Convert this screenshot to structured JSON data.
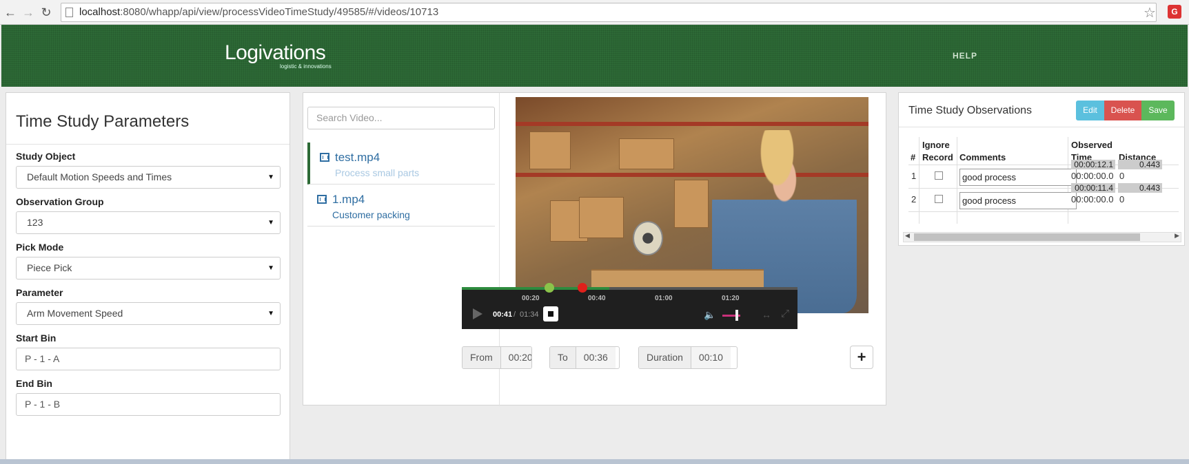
{
  "browser": {
    "url_host": "localhost",
    "url_rest": ":8080/whapp/api/view/processVideoTimeStudy/49585/#/videos/10713"
  },
  "header": {
    "logo": "Logivations",
    "logo_sub": "logistic & innovations",
    "help": "HELP",
    "color": "#2d6a36"
  },
  "params": {
    "title": "Time Study Parameters",
    "study_object": {
      "label": "Study Object",
      "value": "Default Motion Speeds and Times"
    },
    "observation_group": {
      "label": "Observation Group",
      "value": "123"
    },
    "pick_mode": {
      "label": "Pick Mode",
      "value": "Piece Pick"
    },
    "parameter": {
      "label": "Parameter",
      "value": "Arm Movement Speed"
    },
    "start_bin": {
      "label": "Start Bin",
      "value": "P - 1 - A"
    },
    "end_bin": {
      "label": "End Bin",
      "value": "P - 1 - B"
    }
  },
  "videos": {
    "search_placeholder": "Search Video...",
    "items": [
      {
        "name": "test.mp4",
        "desc": "Process small parts",
        "active": true
      },
      {
        "name": "1.mp4",
        "desc": "Customer packing",
        "active": false
      }
    ]
  },
  "player": {
    "ticks": [
      "00:20",
      "00:40",
      "01:00",
      "01:20"
    ],
    "current": "00:41",
    "separator": "/",
    "total": "01:34",
    "progress_fraction": 0.44,
    "start_marker_color": "#8bc34a",
    "end_marker_color": "#e0201b"
  },
  "segment": {
    "from_label": "From",
    "from_value": "00:20",
    "to_label": "To",
    "to_value": "00:36",
    "duration_label": "Duration",
    "duration_value": "00:10",
    "add_label": "+"
  },
  "observations": {
    "title": "Time Study Observations",
    "edit": "Edit",
    "delete": "Delete",
    "save": "Save",
    "headers": {
      "num": "#",
      "ignore": "Ignore Record",
      "comments": "Comments",
      "observed": "Observed Time",
      "distance": "Distance"
    },
    "rows": [
      {
        "num": "1",
        "comment": "good process",
        "observed_badge": "00:00:12.1",
        "observed": "00:00:00.0",
        "distance_badge": "0.443",
        "distance": "0"
      },
      {
        "num": "2",
        "comment": "good process",
        "observed_badge": "00:00:11.4",
        "observed": "00:00:00.0",
        "distance_badge": "0.443",
        "distance": "0"
      }
    ]
  }
}
